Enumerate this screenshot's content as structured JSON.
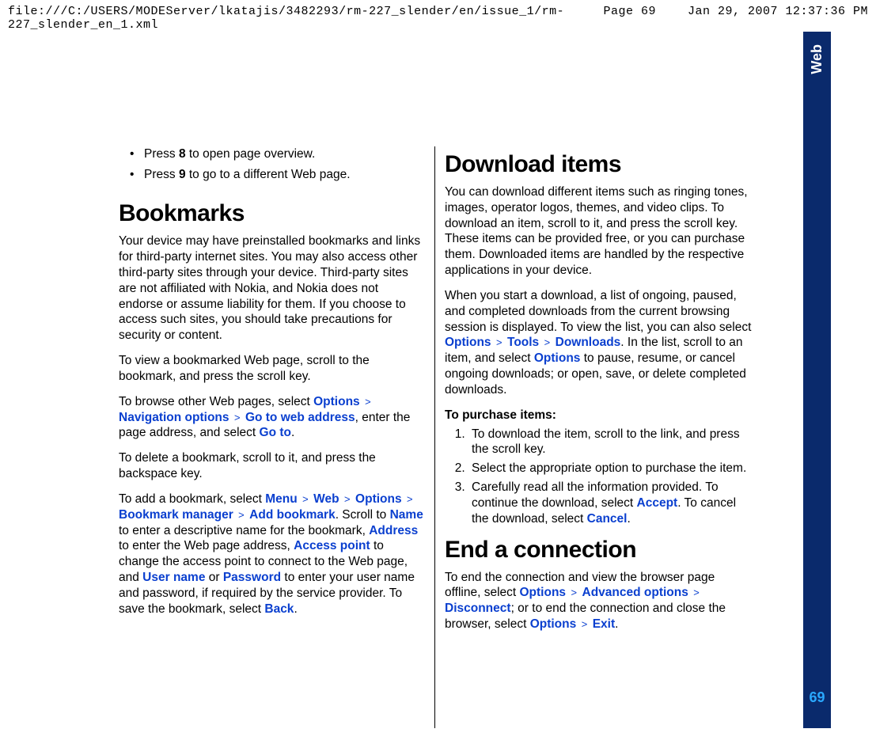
{
  "header": {
    "path": "file:///C:/USERS/MODEServer/lkatajis/3482293/rm-227_slender/en/issue_1/rm-227_slender_en_1.xml",
    "page": "Page 69",
    "datetime": "Jan 29, 2007 12:37:36 PM"
  },
  "sidebar": {
    "section": "Web",
    "page_number": "69"
  },
  "left": {
    "bullets": [
      {
        "pre": "Press ",
        "key": "8",
        "post": " to open page overview."
      },
      {
        "pre": "Press ",
        "key": "9",
        "post": " to go to a different Web page."
      }
    ],
    "h_bookmarks": "Bookmarks",
    "p_bm_intro": "Your device may have preinstalled bookmarks and links for third-party internet sites. You may also access other third-party sites through your device. Third-party sites are not affiliated with Nokia, and Nokia does not endorse or assume liability for them. If you choose to access such sites, you should take precautions for security or content.",
    "p_bm_view": "To view a bookmarked Web page, scroll to the bookmark, and press the scroll key.",
    "browse": {
      "pre": "To browse other Web pages, select ",
      "t1": "Options",
      "t2": "Navigation options",
      "t3": "Go to web address",
      "mid": ", enter the page address, and select ",
      "t4": "Go to",
      "post": "."
    },
    "p_bm_delete": "To delete a bookmark, scroll to it, and press the backspace key.",
    "add": {
      "pre": "To add a bookmark, select ",
      "t1": "Menu",
      "t2": "Web",
      "t3": "Options",
      "t4": "Bookmark manager",
      "t5": "Add bookmark",
      "s1": ". Scroll to ",
      "t6": "Name",
      "s2": " to enter a descriptive name for the bookmark, ",
      "t7": "Address",
      "s3": " to enter the Web page address, ",
      "t8": "Access point",
      "s4": " to change the access point to connect to the Web page, and ",
      "t9": "User name",
      "s5": " or ",
      "t10": "Password",
      "s6": " to enter your user name and password, if required by the service provider. To save the bookmark, select ",
      "t11": "Back",
      "s7": "."
    }
  },
  "right": {
    "h_download": "Download items",
    "p_dl_intro": "You can download different items such as ringing tones, images, operator logos, themes, and video clips. To download an item, scroll to it, and press the scroll key. These items can be provided free, or you can purchase them. Downloaded items are handled by the respective applications in your device.",
    "dl_list": {
      "pre": "When you start a download, a list of ongoing, paused, and completed downloads from the current browsing session is displayed. To view the list, you can also select ",
      "t1": "Options",
      "t2": "Tools",
      "t3": "Downloads",
      "mid1": ". In the list, scroll to an item, and select ",
      "t4": "Options",
      "mid2": " to pause, resume, or cancel ongoing downloads; or open, save, or delete completed downloads."
    },
    "purchase_head": "To purchase items:",
    "ol1": "To download the item, scroll to the link, and press the scroll key.",
    "ol2": "Select the appropriate option to purchase the item.",
    "ol3": {
      "pre": "Carefully read all the information provided. To continue the download, select ",
      "t1": "Accept",
      "mid": ". To cancel the download, select ",
      "t2": "Cancel",
      "post": "."
    },
    "h_end": "End a connection",
    "end": {
      "pre": "To end the connection and view the browser page offline, select ",
      "t1": "Options",
      "t2": "Advanced options",
      "t3": "Disconnect",
      "mid": "; or to end the connection and close the browser, select ",
      "t4": "Options",
      "t5": "Exit",
      "post": "."
    }
  },
  "arrow_glyph": ">"
}
